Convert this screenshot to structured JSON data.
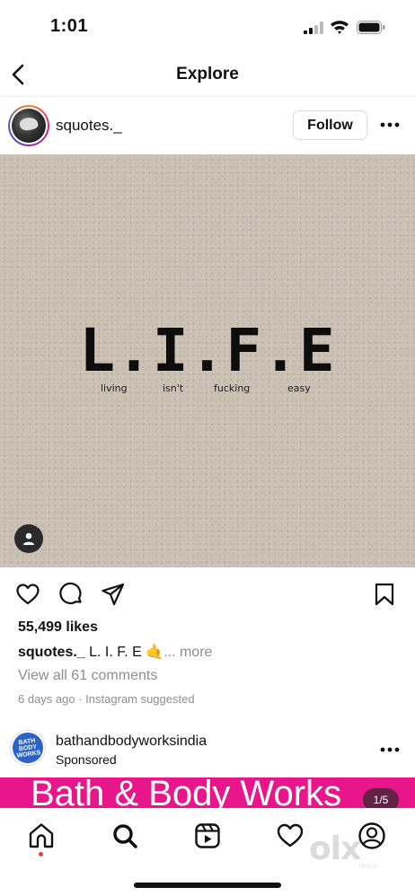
{
  "status_bar": {
    "time": "1:01"
  },
  "nav": {
    "title": "Explore"
  },
  "post": {
    "username": "squotes._",
    "follow_label": "Follow",
    "image": {
      "headline": "L.I.F.E",
      "subwords": [
        "living",
        "isn't",
        "fucking",
        "easy"
      ]
    },
    "likes": "55,499 likes",
    "caption_user": "squotes._",
    "caption_text": " L. I. F. E 🤙",
    "caption_more": "... more",
    "view_comments": "View all 61 comments",
    "time_info": "6 days ago · Instagram suggested"
  },
  "ad": {
    "username": "bathandbodyworksindia",
    "sponsored": "Sponsored",
    "avatar_text": [
      "BATH",
      "BODY",
      "WORKS"
    ],
    "banner_text": "Bath & Body Works",
    "counter": "1/5"
  },
  "watermark": {
    "text": "olx",
    "subtext": "INDIA"
  },
  "colors": {
    "ad_banner": "#e8168a",
    "notification_dot": "#ff3040",
    "accent_ring": "#dd2a7b"
  }
}
